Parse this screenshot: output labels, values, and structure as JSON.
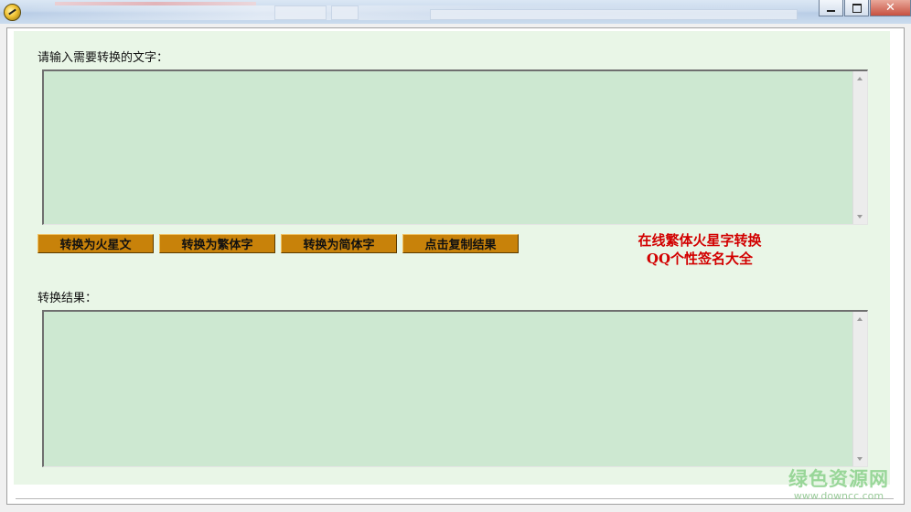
{
  "window": {
    "title_icon": "app-icon",
    "controls": {
      "minimize": "",
      "maximize": "",
      "close": "✕"
    }
  },
  "input_section": {
    "label": "请输入需要转换的文字：",
    "value": ""
  },
  "buttons": {
    "to_martian": "转换为火星文",
    "to_traditional": "转换为繁体字",
    "to_simplified": "转换为简体字",
    "copy_result": "点击复制结果"
  },
  "promo": {
    "line1": "在线繁体火星字转换",
    "line2": "QQ个性签名大全",
    "color": "#d20000"
  },
  "output_section": {
    "label": "转换结果：",
    "value": ""
  },
  "watermark": {
    "main": "绿色资源网",
    "sub": "www.downcc.com"
  },
  "colors": {
    "panel_bg": "#e9f6e7",
    "textarea_bg": "#cde8d1",
    "button_bg": "#c8820a"
  }
}
